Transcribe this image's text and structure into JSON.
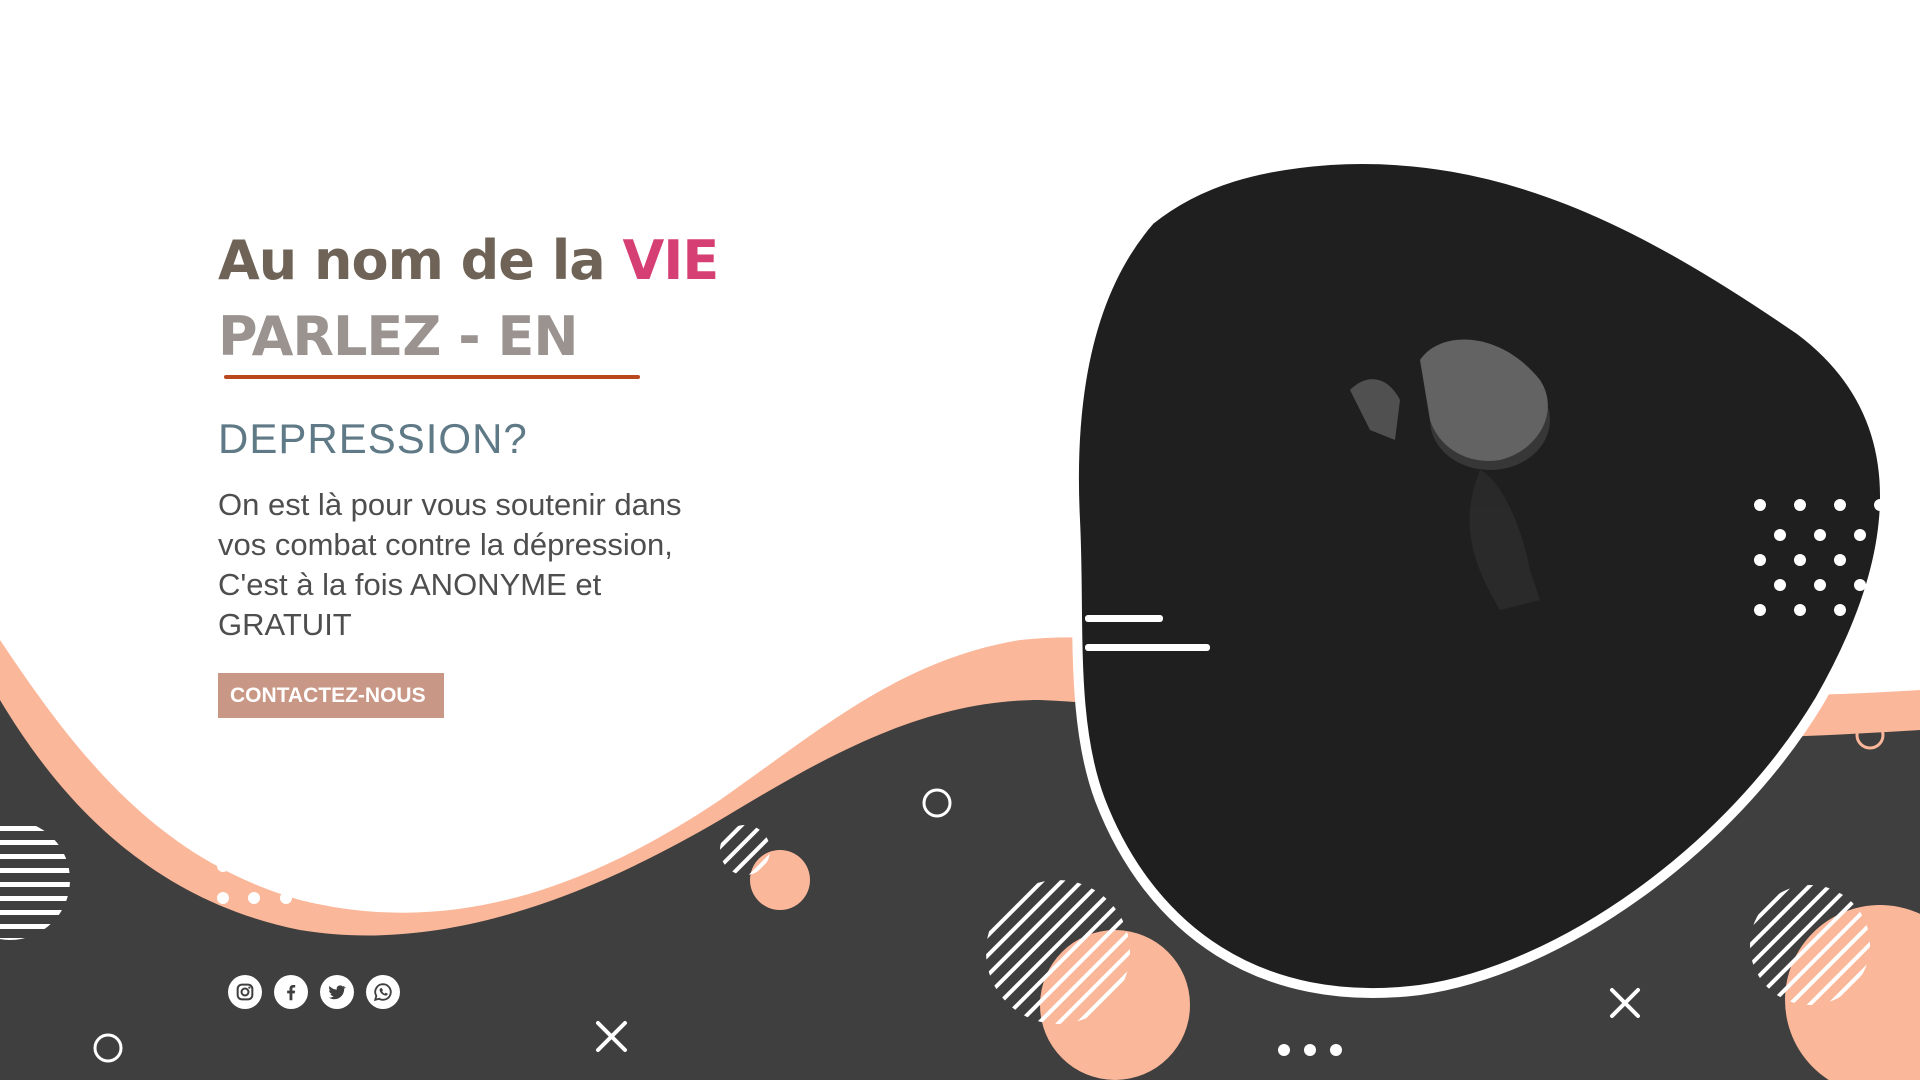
{
  "hero": {
    "headline_prefix": "Au nom de la ",
    "headline_accent": "VIE",
    "subheadline": "PARLEZ - EN",
    "question": "DEPRESSION?",
    "body_line_1": "On est là pour vous soutenir dans",
    "body_line_2": "vos combat contre la dépression,",
    "body_line_3": "C'est à la fois ANONYME et",
    "body_line_4": "GRATUIT",
    "cta_label": "CONTACTEZ-NOUS"
  },
  "socials": [
    {
      "name": "instagram-icon"
    },
    {
      "name": "facebook-icon"
    },
    {
      "name": "twitter-icon"
    },
    {
      "name": "whatsapp-icon"
    }
  ],
  "colors": {
    "headline": "#6e6356",
    "accent": "#d63f73",
    "subheadline": "#9a9390",
    "underline": "#b9471d",
    "question": "#5f7a86",
    "body": "#4e4e4e",
    "cta_bg": "#c99786",
    "dark_wave": "#3f3f3f",
    "peach": "#fbb799",
    "blob": "#1f1f1f"
  }
}
